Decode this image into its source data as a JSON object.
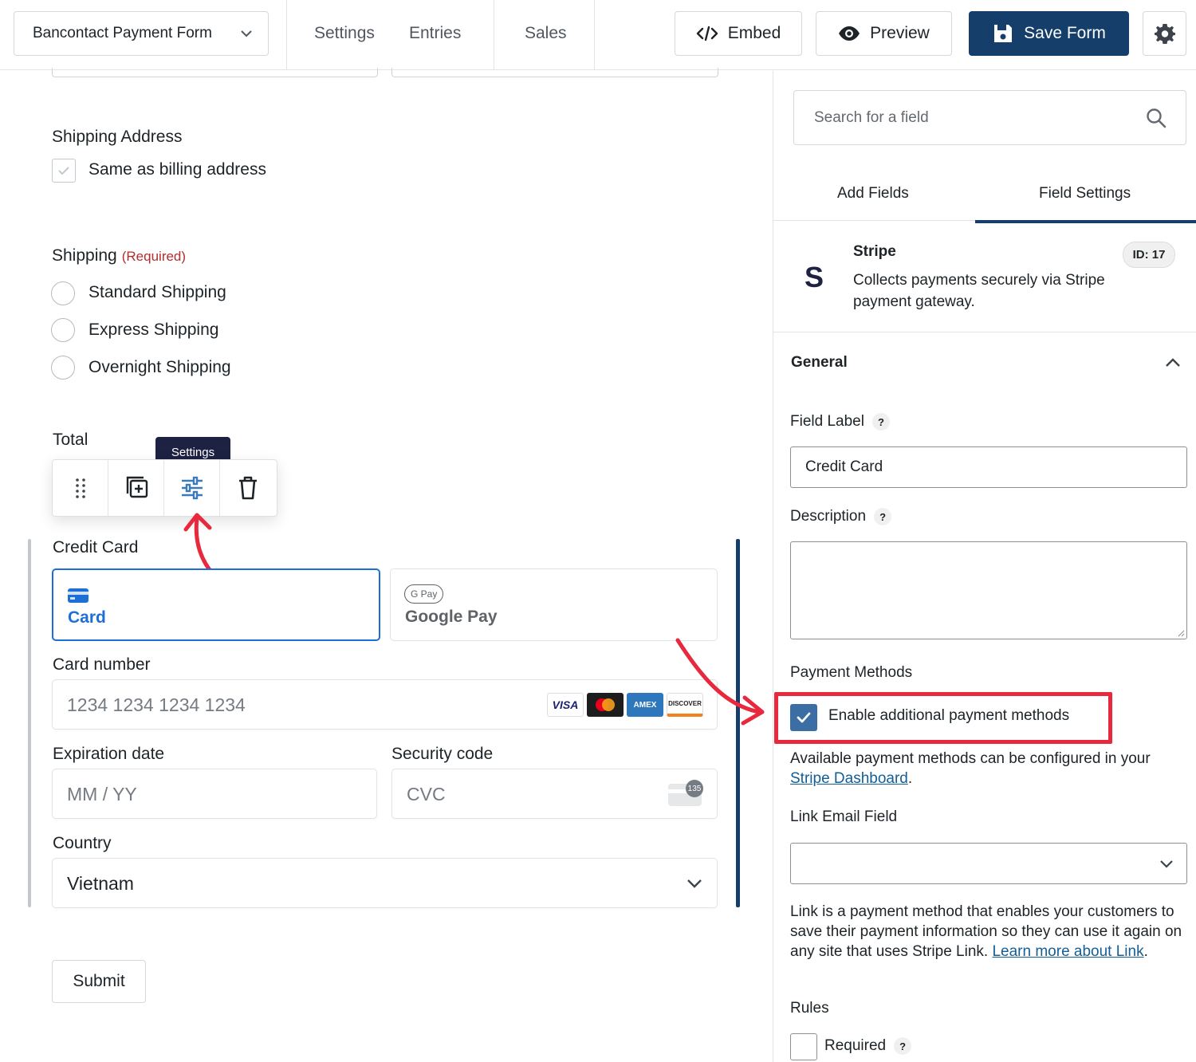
{
  "topbar": {
    "form_selector": "Bancontact Payment Form",
    "nav": [
      "Settings",
      "Entries",
      "Sales"
    ],
    "embed_label": "Embed",
    "preview_label": "Preview",
    "save_label": "Save Form",
    "brand_color": "#153e6a"
  },
  "canvas": {
    "shipping_address": {
      "label": "Shipping Address",
      "checkbox_label": "Same as billing address"
    },
    "shipping": {
      "label": "Shipping",
      "required": "(Required)",
      "options": [
        "Standard Shipping",
        "Express Shipping",
        "Overnight Shipping"
      ]
    },
    "total_label": "Total",
    "tooltip": "Settings",
    "credit_card": {
      "label": "Credit Card",
      "tabs": [
        "Card",
        "Google Pay"
      ],
      "gpay_badge": "G Pay",
      "card_number_label": "Card number",
      "card_number_placeholder": "1234 1234 1234 1234",
      "card_brands": [
        "VISA",
        "Mastercard",
        "AMEX",
        "DISCOVER"
      ],
      "expiration_label": "Expiration date",
      "expiration_placeholder": "MM / YY",
      "security_label": "Security code",
      "security_placeholder": "CVC",
      "cvc_badge": "135",
      "country_label": "Country",
      "country_value": "Vietnam"
    },
    "submit_label": "Submit"
  },
  "sidebar": {
    "search_placeholder": "Search for a field",
    "tabs": [
      "Add Fields",
      "Field Settings"
    ],
    "active_tab": "Field Settings",
    "field": {
      "icon_letter": "S",
      "title": "Stripe",
      "description": "Collects payments securely via Stripe payment gateway.",
      "id_badge": "ID: 17"
    },
    "general_title": "General",
    "field_label_label": "Field Label",
    "field_label_value": "Credit Card",
    "description_label": "Description",
    "help_mark": "?",
    "payment_methods_label": "Payment Methods",
    "enable_additional_label": "Enable additional payment methods",
    "available_text": "Available payment methods can be configured in your",
    "stripe_dashboard_link": "Stripe Dashboard",
    "link_email_label": "Link Email Field",
    "link_text": "Link is a payment method that enables your customers to save their payment information so they can use it again on any site that uses Stripe Link.",
    "learn_more_link": "Learn more about Link",
    "rules_label": "Rules",
    "required_label": "Required",
    "annotation_color": "#e8283c"
  }
}
